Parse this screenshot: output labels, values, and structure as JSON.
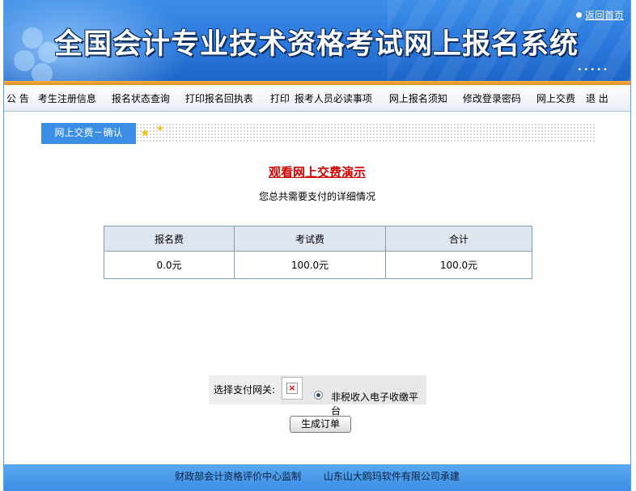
{
  "header": {
    "site_title": "全国会计专业技术资格考试网上报名系统",
    "home_link": "返回首页",
    "dots": "•••••"
  },
  "nav": {
    "items": [
      "公 告",
      "考生注册信息",
      "报名状态查询",
      "打印报名回执表",
      "打印",
      "报考人员必读事项",
      "网上报名须知",
      "修改登录密码",
      "网上交费",
      "退 出"
    ]
  },
  "section": {
    "tab_label": "网上交费－确认"
  },
  "demo_link": "观看网上交费演示",
  "subtitle": "您总共需要支付的详细情况",
  "fee_table": {
    "headers": [
      "报名费",
      "考试费",
      "合计"
    ],
    "row": [
      "0.0元",
      "100.0元",
      "100.0元"
    ]
  },
  "payment": {
    "label": "选择支付网关:",
    "option": "非税收入电子收缴平台",
    "selected": true
  },
  "submit_label": "生成订单",
  "footer": {
    "left": "财政部会计资格评价中心监制",
    "right": "山东山大鸥玛软件有限公司承建"
  },
  "colors": {
    "accent_blue": "#3b8ee6",
    "nav_orange": "#f0a030",
    "link_red": "#d40000"
  }
}
